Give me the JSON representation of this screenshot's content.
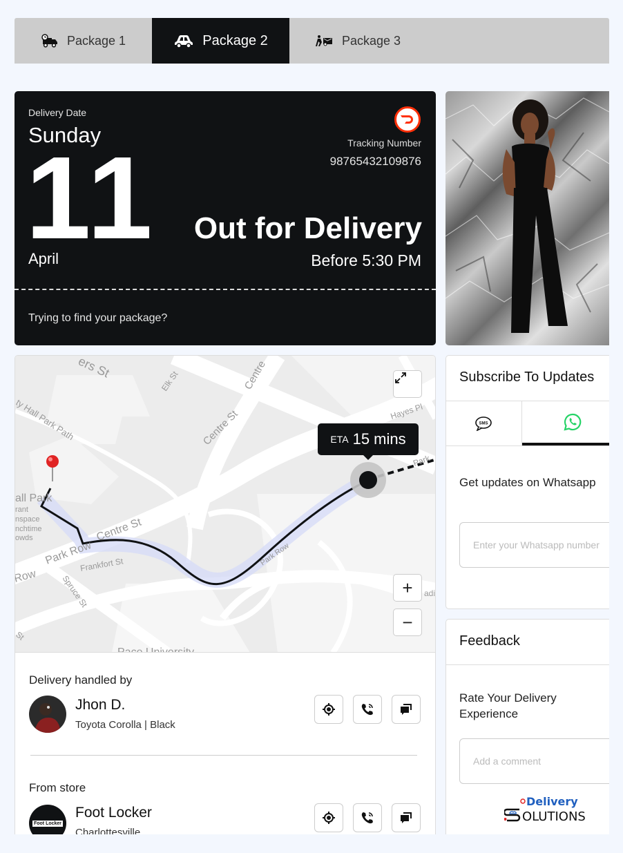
{
  "tabs": [
    {
      "label": "Package 1",
      "icon": "delivery-truck-icon",
      "active": false
    },
    {
      "label": "Package 2",
      "icon": "car-icon",
      "active": true
    },
    {
      "label": "Package 3",
      "icon": "delivery-person-icon",
      "active": false
    }
  ],
  "hero": {
    "delivery_date_label": "Delivery Date",
    "day_of_week": "Sunday",
    "day_number": "11",
    "month": "April",
    "carrier_logo": "doordash-logo-icon",
    "tracking_label": "Tracking Number",
    "tracking_number": "98765432109876",
    "status": "Out for Delivery",
    "delivery_window": "Before 5:30 PM",
    "find_link": "Trying to find your package?"
  },
  "map": {
    "eta_label": "ETA",
    "eta_value": "15 mins",
    "street_labels": [
      "ers St",
      "Elk St",
      "Centre St",
      "Centre",
      "ty Hall Park Path",
      "Hayes Pl",
      "Park",
      "all Park",
      "rant",
      "nspace",
      "nchtime",
      "owds",
      "Park Row",
      "Centre St",
      "Frankfort St",
      "Park Row",
      "Row",
      "Spruce St",
      "St",
      "Pace University",
      "adis"
    ],
    "expand_icon": "expand-icon",
    "zoom_in_label": "+",
    "zoom_out_label": "−",
    "colors": {
      "route": "#101214",
      "pin": "#e02424"
    }
  },
  "driver": {
    "section_label": "Delivery handled by",
    "name": "Jhon D.",
    "vehicle": "Toyota Corolla | Black"
  },
  "store": {
    "section_label": "From store",
    "name": "Foot Locker",
    "location": "Charlottesville",
    "logo_text": "Foot Locker"
  },
  "subscribe": {
    "title": "Subscribe To Updates",
    "tabs": [
      {
        "icon": "sms-icon",
        "active": false
      },
      {
        "icon": "whatsapp-icon",
        "active": true
      }
    ],
    "hint": "Get updates on Whatsapp",
    "input_placeholder": "Enter your Whatsapp number"
  },
  "feedback": {
    "title": "Feedback",
    "rate_label": "Rate Your Delivery Experience",
    "comment_placeholder": "Add a comment"
  },
  "branding": {
    "line1": "Delivery",
    "line2": "OLUTIONS",
    "colors": {
      "blue": "#1f5fbf",
      "red": "#e02424"
    }
  }
}
